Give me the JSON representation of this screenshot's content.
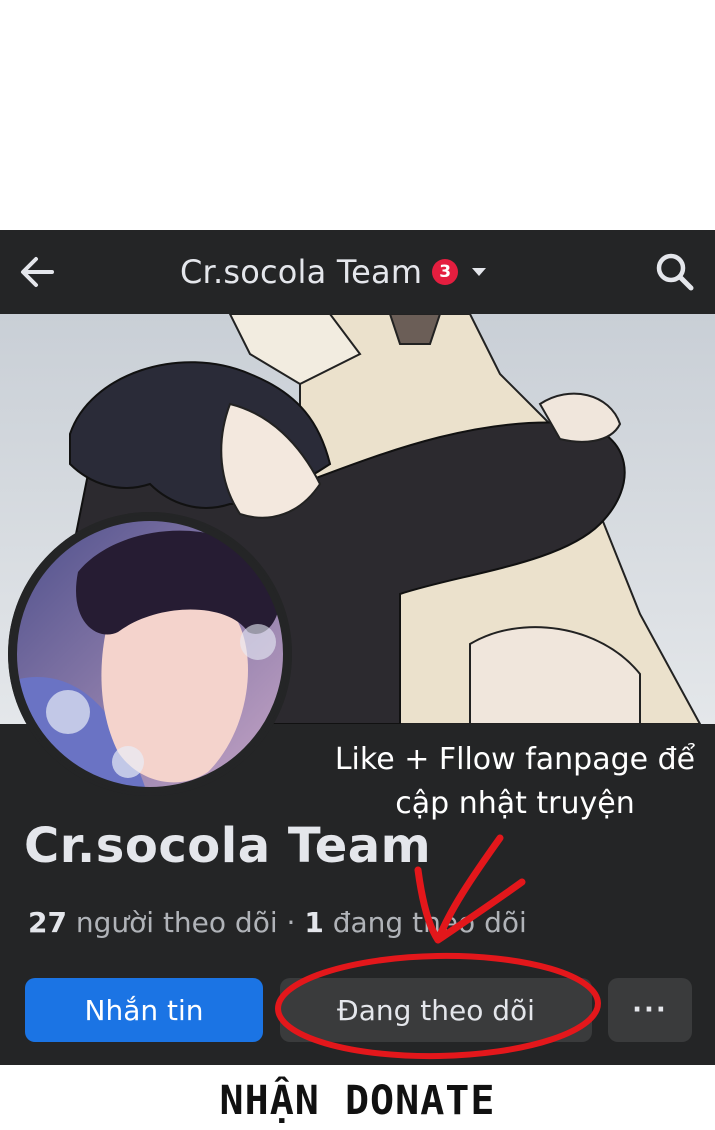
{
  "header": {
    "title": "Cr.socola Team",
    "notification_count": "3",
    "back_icon": "back-arrow-icon",
    "search_icon": "search-icon",
    "dropdown_icon": "caret-down-icon"
  },
  "page": {
    "name": "Cr.socola Team",
    "followers_count": "27",
    "followers_label": "người theo dõi",
    "separator": "·",
    "following_count": "1",
    "following_label": "đang theo dõi"
  },
  "actions": {
    "message_label": "Nhắn tin",
    "following_label": "Đang theo dõi",
    "more_label": "···"
  },
  "annotation": {
    "line1": "Like + Fllow fanpage để",
    "line2": "cập nhật truyện"
  },
  "footer": {
    "text": "NHẬN DONATE"
  },
  "colors": {
    "header_bg": "#242526",
    "primary_button": "#1b74e4",
    "secondary_button": "#3a3b3c",
    "badge": "#e41e3f",
    "annotation_ink": "#e3171b"
  }
}
